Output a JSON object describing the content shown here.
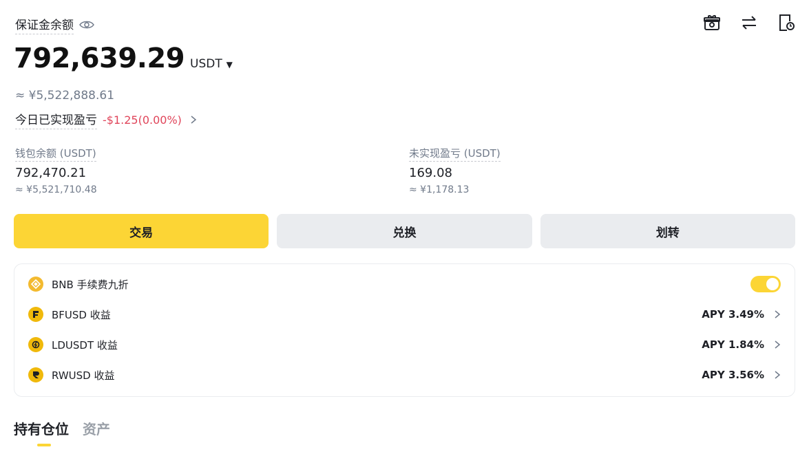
{
  "header": {
    "title": "保证金余额",
    "eye_icon": "eye-icon",
    "icons": [
      "gift-icon",
      "transfer-icon",
      "history-icon"
    ]
  },
  "balance": {
    "amount": "792,639.29",
    "unit": "USDT",
    "approx": "≈ ¥5,522,888.61"
  },
  "pnl": {
    "label": "今日已实现盈亏",
    "value": "-$1.25(0.00%)"
  },
  "wallet": {
    "label": "钱包余额 (USDT)",
    "value": "792,470.21",
    "approx": "≈ ¥5,521,710.48"
  },
  "unrealized": {
    "label": "未实现盈亏 (USDT)",
    "value": "169.08",
    "approx": "≈ ¥1,178.13"
  },
  "actions": {
    "trade": "交易",
    "convert": "兑换",
    "transfer": "划转"
  },
  "earn": {
    "bnb": {
      "name": "BNB 手续费九折",
      "enabled": true
    },
    "items": [
      {
        "name": "BFUSD 收益",
        "apy": "APY 3.49%",
        "icon": "bfusd-coin-icon"
      },
      {
        "name": "LDUSDT 收益",
        "apy": "APY 1.84%",
        "icon": "ldusdt-coin-icon"
      },
      {
        "name": "RWUSD 收益",
        "apy": "APY 3.56%",
        "icon": "rwusd-coin-icon"
      }
    ]
  },
  "tabs": [
    "持有仓位",
    "资产"
  ],
  "colors": {
    "accent": "#fcd535",
    "negative": "#e0455a",
    "muted": "#707a8a"
  }
}
